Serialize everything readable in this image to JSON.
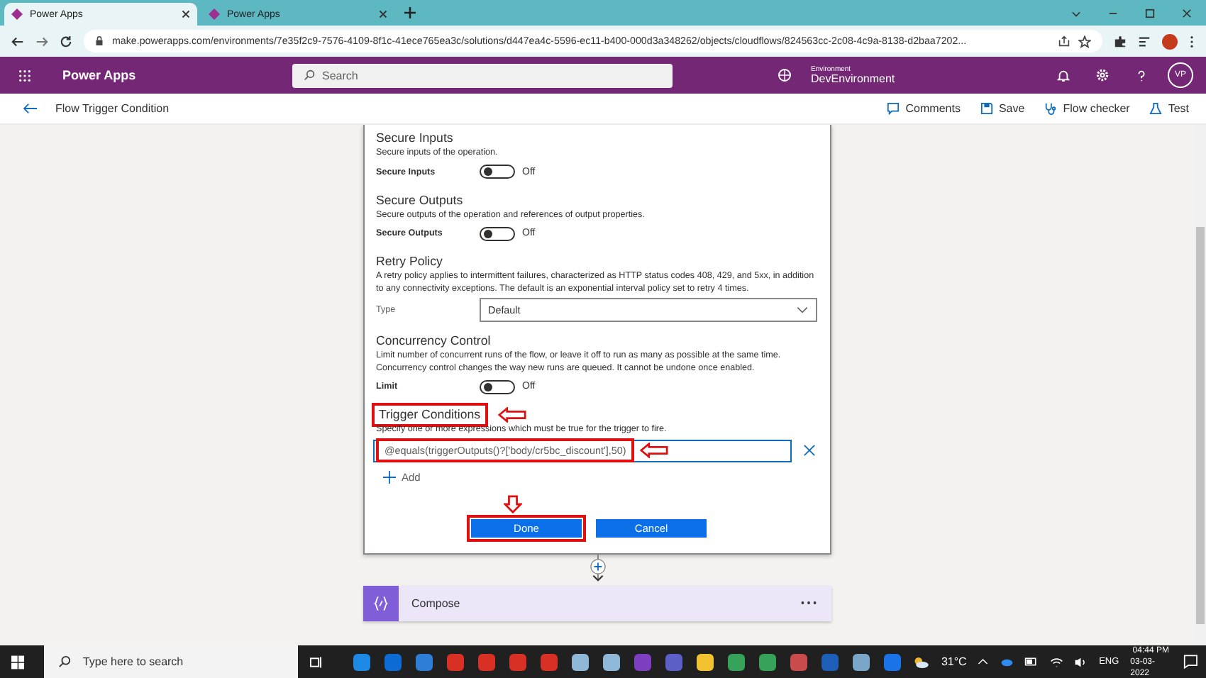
{
  "browser": {
    "tabs": [
      {
        "title": "Power Apps",
        "selected": true
      },
      {
        "title": "Power Apps",
        "selected": false
      }
    ],
    "url": "make.powerapps.com/environments/7e35f2c9-7576-4109-8f1c-41ece765ea3c/solutions/d447ea4c-5596-ec11-b400-000d3a348262/objects/cloudflows/824563cc-2c08-4c9a-8138-d2baa7202..."
  },
  "app_bar": {
    "name": "Power Apps",
    "search_placeholder": "Search",
    "environment_label": "Environment",
    "environment": "DevEnvironment",
    "avatar": "VP"
  },
  "command_bar": {
    "title": "Flow Trigger Condition",
    "actions": [
      {
        "kind": "comments",
        "label": "Comments"
      },
      {
        "kind": "save",
        "label": "Save"
      },
      {
        "kind": "checker",
        "label": "Flow checker"
      },
      {
        "kind": "test",
        "label": "Test"
      }
    ]
  },
  "settings": [
    {
      "kind": "toggle",
      "title": "Secure Inputs",
      "description": "Secure inputs of the operation.",
      "label": "Secure Inputs",
      "on": false,
      "state": "Off"
    },
    {
      "kind": "toggle",
      "title": "Secure Outputs",
      "description": "Secure outputs of the operation and references of output properties.",
      "label": "Secure Outputs",
      "on": false,
      "state": "Off"
    },
    {
      "kind": "select",
      "title": "Retry Policy",
      "description": "A retry policy applies to intermittent failures, characterized as HTTP status codes 408, 429, and 5xx, in addition to any connectivity exceptions. The default is an exponential interval policy set to retry 4 times.",
      "label": "Type",
      "value": "Default"
    },
    {
      "kind": "toggle",
      "title": "Concurrency Control",
      "description": "Limit number of concurrent runs of the flow, or leave it off to run as many as possible at the same time. Concurrency control changes the way new runs are queued. It cannot be undone once enabled.",
      "label": "Limit",
      "on": false,
      "state": "Off"
    },
    {
      "kind": "conditions",
      "title": "Trigger Conditions",
      "title_highlighted": true,
      "description": "Specify one or more expressions which must be true for the trigger to fire.",
      "expression": "@equals(triggerOutputs()?['body/cr5bc_discount'],50)",
      "expression_highlighted": true,
      "add": "Add"
    }
  ],
  "buttons": [
    {
      "label": "Done",
      "highlighted": true
    },
    {
      "label": "Cancel",
      "highlighted": false
    }
  ],
  "next_action": {
    "title": "Compose"
  },
  "taskbar": {
    "search_placeholder": "Type here to search",
    "weather": "31°C",
    "language": "ENG",
    "time": "04:44 PM",
    "date": "03-03-2022"
  }
}
